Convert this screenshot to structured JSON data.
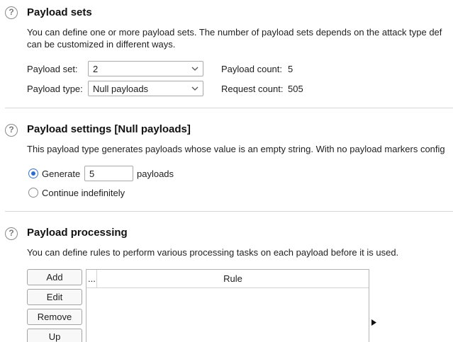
{
  "payload_sets": {
    "title": "Payload sets",
    "description_line1": "You can define one or more payload sets. The number of payload sets depends on the attack type def",
    "description_line2": "can be customized in different ways.",
    "set_label": "Payload set:",
    "set_value": "2",
    "type_label": "Payload type:",
    "type_value": "Null payloads",
    "count_label": "Payload count:",
    "count_value": "5",
    "request_label": "Request count:",
    "request_value": "505"
  },
  "payload_settings": {
    "title": "Payload settings [Null payloads]",
    "description": "This payload type generates payloads whose value is an empty string. With no payload markers config",
    "generate_label": "Generate",
    "generate_value": "5",
    "payloads_suffix": "payloads",
    "generate_selected": true,
    "continue_label": "Continue indefinitely",
    "continue_selected": false
  },
  "payload_processing": {
    "title": "Payload processing",
    "description": "You can define rules to perform various processing tasks on each payload before it is used.",
    "buttons": {
      "add": "Add",
      "edit": "Edit",
      "remove": "Remove",
      "up": "Up"
    },
    "table": {
      "col_ellipsis": "...",
      "col_rule": "Rule",
      "rows": []
    }
  },
  "help_glyph": "?",
  "icons": {
    "help": "help-circle-icon",
    "dropdown": "chevron-down-icon",
    "cursor": "mouse-pointer-icon"
  },
  "colors": {
    "accent": "#2f6cc8",
    "divider": "#d6d6d6"
  }
}
